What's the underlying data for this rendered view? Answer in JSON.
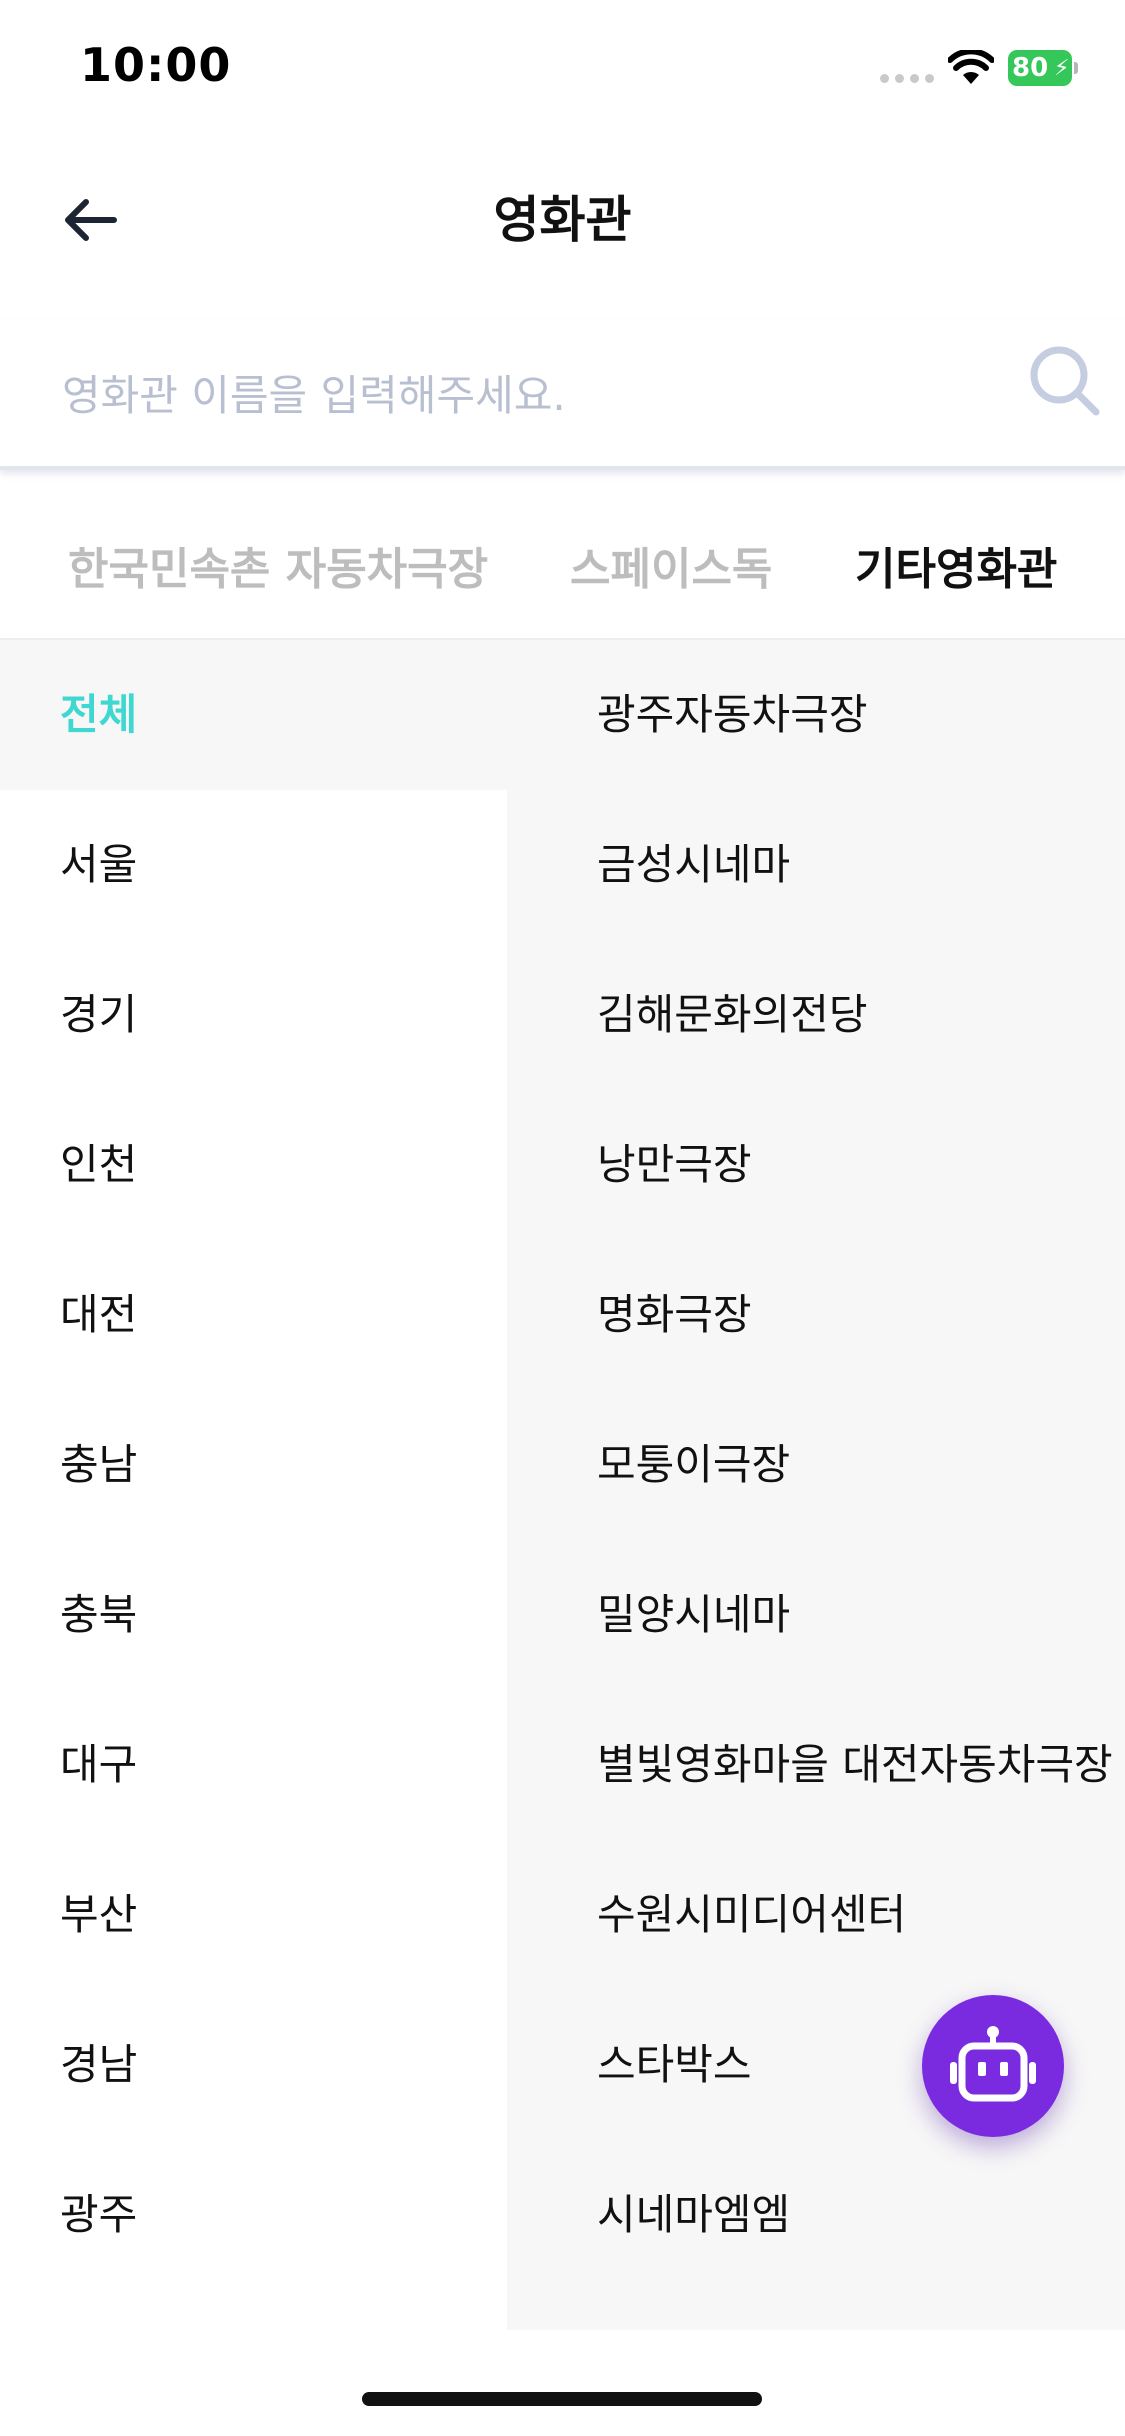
{
  "status_bar": {
    "time": "10:00",
    "battery": "80"
  },
  "header": {
    "title": "영화관",
    "back_icon": "arrow-left-icon"
  },
  "search": {
    "placeholder": "영화관 이름을 입력해주세요.",
    "icon": "search-icon"
  },
  "tabs": [
    {
      "label": "한국민속촌 자동차극장",
      "active": false
    },
    {
      "label": "스페이스독",
      "active": false
    },
    {
      "label": "기타영화관",
      "active": true
    }
  ],
  "regions": [
    {
      "label": "전체",
      "active": true
    },
    {
      "label": "서울"
    },
    {
      "label": "경기"
    },
    {
      "label": "인천"
    },
    {
      "label": "대전"
    },
    {
      "label": "충남"
    },
    {
      "label": "충북"
    },
    {
      "label": "대구"
    },
    {
      "label": "부산"
    },
    {
      "label": "경남"
    },
    {
      "label": "광주"
    }
  ],
  "theaters": [
    "광주자동차극장",
    "금성시네마",
    "김해문화의전당",
    "낭만극장",
    "명화극장",
    "모퉁이극장",
    "밀양시네마",
    "별빛영화마을 대전자동차극장",
    "수원시미디어센터",
    "스타박스",
    "시네마엠엠"
  ],
  "fab": {
    "icon": "robot-icon"
  },
  "colors": {
    "accent": "#3fd8d0",
    "fab": "#7a2be0",
    "battery": "#35c759"
  }
}
